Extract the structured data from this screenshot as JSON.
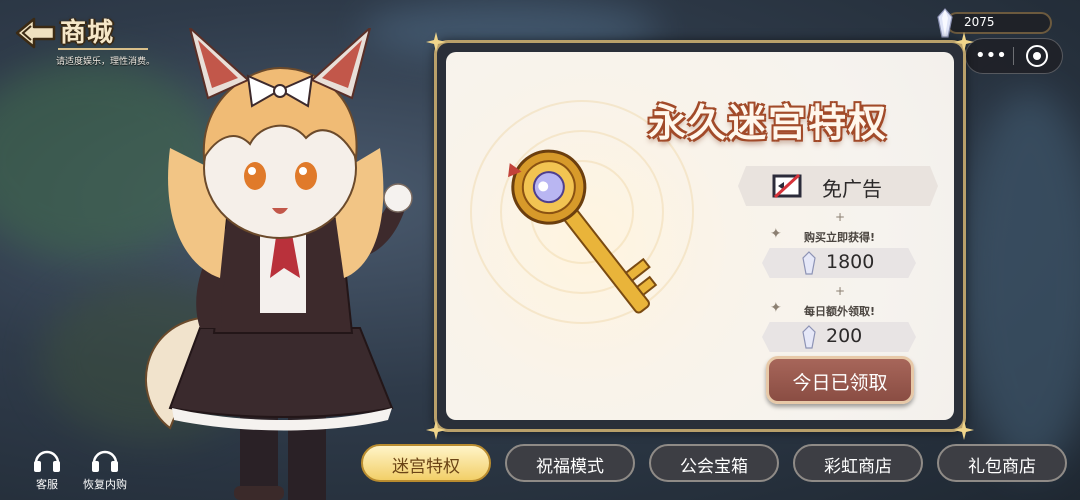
{
  "header": {
    "title": "商城",
    "subtitle": "请适度娱乐，理性消费。"
  },
  "currency": {
    "amount": "2075",
    "icon": "crystal-icon"
  },
  "capsule": {
    "menu_icon": "•••",
    "close_icon": "target-close-icon"
  },
  "utilities": [
    {
      "label": "客服",
      "icon": "headset-icon"
    },
    {
      "label": "恢复内购",
      "icon": "headset-icon"
    }
  ],
  "panel": {
    "title": "永久迷宫特权",
    "feature": {
      "label": "免广告",
      "icon": "no-ads-icon"
    },
    "plus": "+",
    "instant": {
      "label": "购买立即获得!",
      "value": "1800"
    },
    "daily": {
      "label": "每日额外领取!",
      "value": "200"
    },
    "claim_button": "今日已领取"
  },
  "tabs": [
    {
      "label": "迷宫特权",
      "active": true
    },
    {
      "label": "祝福模式",
      "active": false
    },
    {
      "label": "公会宝箱",
      "active": false
    },
    {
      "label": "彩虹商店",
      "active": false
    },
    {
      "label": "礼包商店",
      "active": false
    }
  ],
  "colors": {
    "accent_gold": "#f2cf68",
    "panel_title_outline": "#a24b2a",
    "claim_button": "#8a4d43"
  }
}
